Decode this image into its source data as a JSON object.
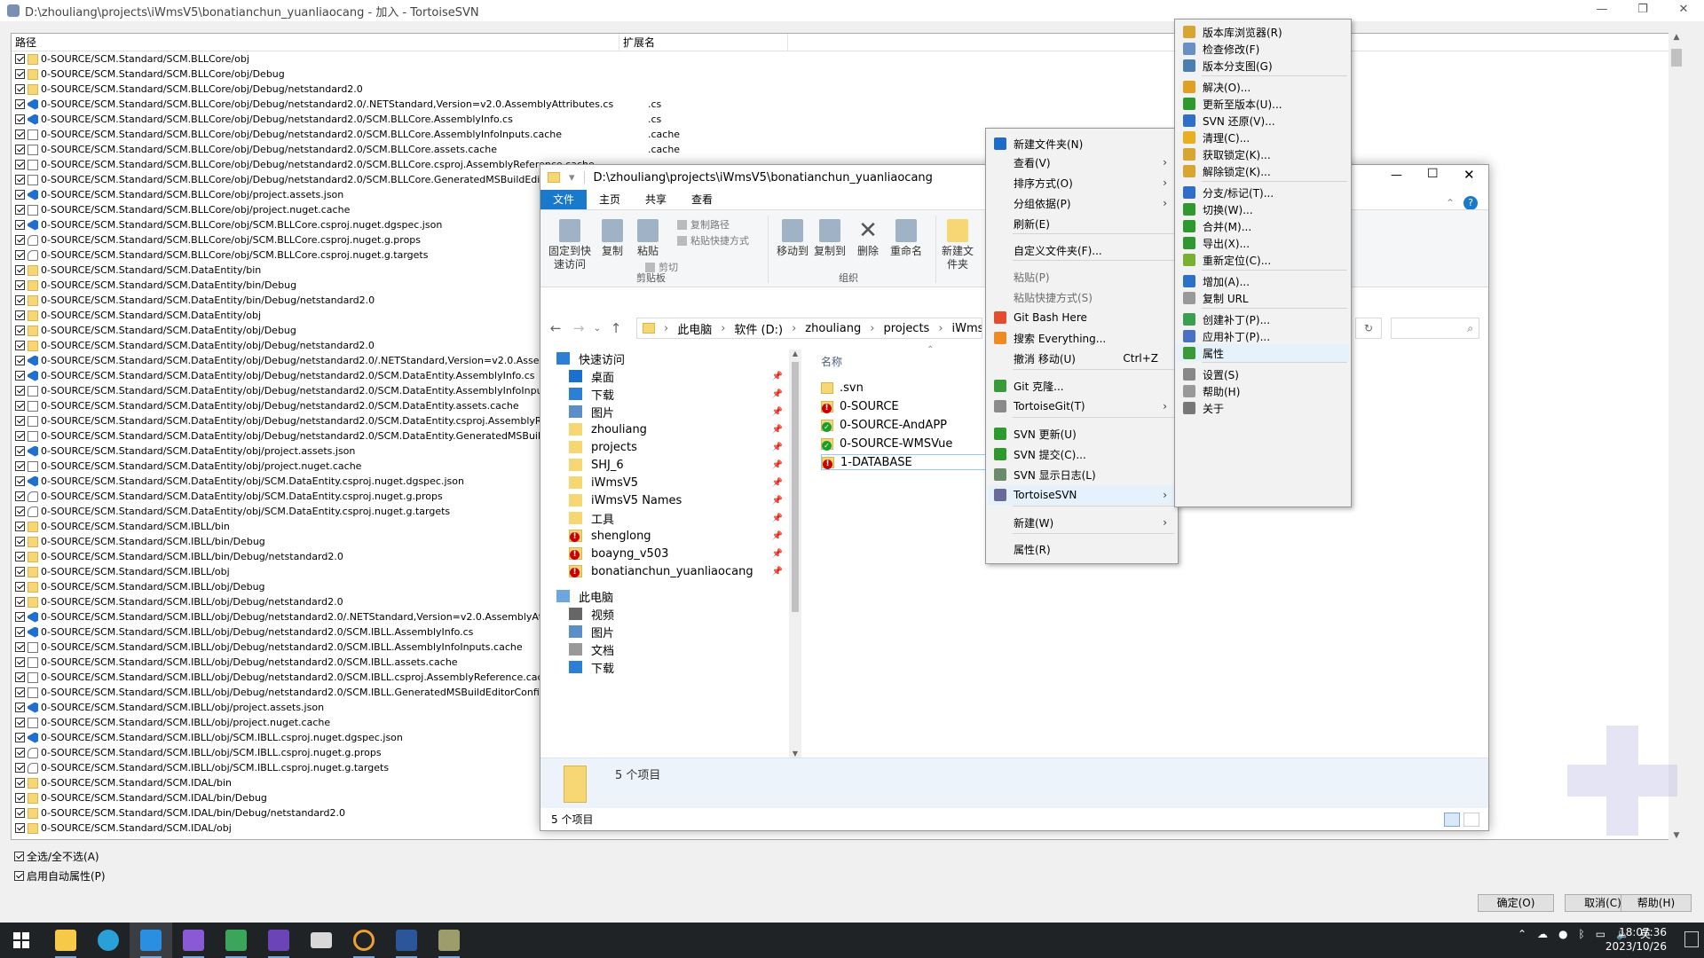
{
  "svn": {
    "title": "D:\\zhouliang\\projects\\iWmsV5\\bonatianchun_yuanliaocang - 加入 - TortoiseSVN",
    "col_path": "路径",
    "col_ext": "扩展名",
    "files": [
      {
        "path": "0-SOURCE/SCM.Standard/SCM.BLLCore/obj",
        "ext": "",
        "icon": "folder"
      },
      {
        "path": "0-SOURCE/SCM.Standard/SCM.BLLCore/obj/Debug",
        "ext": "",
        "icon": "folder"
      },
      {
        "path": "0-SOURCE/SCM.Standard/SCM.BLLCore/obj/Debug/netstandard2.0",
        "ext": "",
        "icon": "folder"
      },
      {
        "path": "0-SOURCE/SCM.Standard/SCM.BLLCore/obj/Debug/netstandard2.0/.NETStandard,Version=v2.0.AssemblyAttributes.cs",
        "ext": ".cs",
        "icon": "vs"
      },
      {
        "path": "0-SOURCE/SCM.Standard/SCM.BLLCore/obj/Debug/netstandard2.0/SCM.BLLCore.AssemblyInfo.cs",
        "ext": ".cs",
        "icon": "vs"
      },
      {
        "path": "0-SOURCE/SCM.Standard/SCM.BLLCore/obj/Debug/netstandard2.0/SCM.BLLCore.AssemblyInfoInputs.cache",
        "ext": ".cache",
        "icon": "file"
      },
      {
        "path": "0-SOURCE/SCM.Standard/SCM.BLLCore/obj/Debug/netstandard2.0/SCM.BLLCore.assets.cache",
        "ext": ".cache",
        "icon": "file"
      },
      {
        "path": "0-SOURCE/SCM.Standard/SCM.BLLCore/obj/Debug/netstandard2.0/SCM.BLLCore.csproj.AssemblyReference.cache",
        "ext": "",
        "icon": "file"
      },
      {
        "path": "0-SOURCE/SCM.Standard/SCM.BLLCore/obj/Debug/netstandard2.0/SCM.BLLCore.GeneratedMSBuildEditorConfig.ed",
        "ext": "",
        "icon": "file"
      },
      {
        "path": "0-SOURCE/SCM.Standard/SCM.BLLCore/obj/project.assets.json",
        "ext": "",
        "icon": "vs"
      },
      {
        "path": "0-SOURCE/SCM.Standard/SCM.BLLCore/obj/project.nuget.cache",
        "ext": "",
        "icon": "file"
      },
      {
        "path": "0-SOURCE/SCM.Standard/SCM.BLLCore/obj/SCM.BLLCore.csproj.nuget.dgspec.json",
        "ext": "",
        "icon": "vs"
      },
      {
        "path": "0-SOURCE/SCM.Standard/SCM.BLLCore/obj/SCM.BLLCore.csproj.nuget.g.props",
        "ext": "",
        "icon": "cfg"
      },
      {
        "path": "0-SOURCE/SCM.Standard/SCM.BLLCore/obj/SCM.BLLCore.csproj.nuget.g.targets",
        "ext": "",
        "icon": "cfg"
      },
      {
        "path": "0-SOURCE/SCM.Standard/SCM.DataEntity/bin",
        "ext": "",
        "icon": "folder"
      },
      {
        "path": "0-SOURCE/SCM.Standard/SCM.DataEntity/bin/Debug",
        "ext": "",
        "icon": "folder"
      },
      {
        "path": "0-SOURCE/SCM.Standard/SCM.DataEntity/bin/Debug/netstandard2.0",
        "ext": "",
        "icon": "folder"
      },
      {
        "path": "0-SOURCE/SCM.Standard/SCM.DataEntity/obj",
        "ext": "",
        "icon": "folder"
      },
      {
        "path": "0-SOURCE/SCM.Standard/SCM.DataEntity/obj/Debug",
        "ext": "",
        "icon": "folder"
      },
      {
        "path": "0-SOURCE/SCM.Standard/SCM.DataEntity/obj/Debug/netstandard2.0",
        "ext": "",
        "icon": "folder"
      },
      {
        "path": "0-SOURCE/SCM.Standard/SCM.DataEntity/obj/Debug/netstandard2.0/.NETStandard,Version=v2.0.AssemblyAttribu",
        "ext": "",
        "icon": "vs"
      },
      {
        "path": "0-SOURCE/SCM.Standard/SCM.DataEntity/obj/Debug/netstandard2.0/SCM.DataEntity.AssemblyInfo.cs",
        "ext": "",
        "icon": "vs"
      },
      {
        "path": "0-SOURCE/SCM.Standard/SCM.DataEntity/obj/Debug/netstandard2.0/SCM.DataEntity.AssemblyInfoInputs.cache",
        "ext": "",
        "icon": "file"
      },
      {
        "path": "0-SOURCE/SCM.Standard/SCM.DataEntity/obj/Debug/netstandard2.0/SCM.DataEntity.assets.cache",
        "ext": "",
        "icon": "file"
      },
      {
        "path": "0-SOURCE/SCM.Standard/SCM.DataEntity/obj/Debug/netstandard2.0/SCM.DataEntity.csproj.AssemblyReference.c",
        "ext": "",
        "icon": "file"
      },
      {
        "path": "0-SOURCE/SCM.Standard/SCM.DataEntity/obj/Debug/netstandard2.0/SCM.DataEntity.GeneratedMSBuildEditorConf",
        "ext": "",
        "icon": "file"
      },
      {
        "path": "0-SOURCE/SCM.Standard/SCM.DataEntity/obj/project.assets.json",
        "ext": "",
        "icon": "vs"
      },
      {
        "path": "0-SOURCE/SCM.Standard/SCM.DataEntity/obj/project.nuget.cache",
        "ext": "",
        "icon": "file"
      },
      {
        "path": "0-SOURCE/SCM.Standard/SCM.DataEntity/obj/SCM.DataEntity.csproj.nuget.dgspec.json",
        "ext": "",
        "icon": "vs"
      },
      {
        "path": "0-SOURCE/SCM.Standard/SCM.DataEntity/obj/SCM.DataEntity.csproj.nuget.g.props",
        "ext": "",
        "icon": "cfg"
      },
      {
        "path": "0-SOURCE/SCM.Standard/SCM.DataEntity/obj/SCM.DataEntity.csproj.nuget.g.targets",
        "ext": "",
        "icon": "cfg"
      },
      {
        "path": "0-SOURCE/SCM.Standard/SCM.IBLL/bin",
        "ext": "",
        "icon": "folder"
      },
      {
        "path": "0-SOURCE/SCM.Standard/SCM.IBLL/bin/Debug",
        "ext": "",
        "icon": "folder"
      },
      {
        "path": "0-SOURCE/SCM.Standard/SCM.IBLL/bin/Debug/netstandard2.0",
        "ext": "",
        "icon": "folder"
      },
      {
        "path": "0-SOURCE/SCM.Standard/SCM.IBLL/obj",
        "ext": "",
        "icon": "folder"
      },
      {
        "path": "0-SOURCE/SCM.Standard/SCM.IBLL/obj/Debug",
        "ext": "",
        "icon": "folder"
      },
      {
        "path": "0-SOURCE/SCM.Standard/SCM.IBLL/obj/Debug/netstandard2.0",
        "ext": "",
        "icon": "folder"
      },
      {
        "path": "0-SOURCE/SCM.Standard/SCM.IBLL/obj/Debug/netstandard2.0/.NETStandard,Version=v2.0.AssemblyAttributes.cs",
        "ext": "",
        "icon": "vs"
      },
      {
        "path": "0-SOURCE/SCM.Standard/SCM.IBLL/obj/Debug/netstandard2.0/SCM.IBLL.AssemblyInfo.cs",
        "ext": "",
        "icon": "vs"
      },
      {
        "path": "0-SOURCE/SCM.Standard/SCM.IBLL/obj/Debug/netstandard2.0/SCM.IBLL.AssemblyInfoInputs.cache",
        "ext": "",
        "icon": "file"
      },
      {
        "path": "0-SOURCE/SCM.Standard/SCM.IBLL/obj/Debug/netstandard2.0/SCM.IBLL.assets.cache",
        "ext": "",
        "icon": "file"
      },
      {
        "path": "0-SOURCE/SCM.Standard/SCM.IBLL/obj/Debug/netstandard2.0/SCM.IBLL.csproj.AssemblyReference.cache",
        "ext": "",
        "icon": "file"
      },
      {
        "path": "0-SOURCE/SCM.Standard/SCM.IBLL/obj/Debug/netstandard2.0/SCM.IBLL.GeneratedMSBuildEditorConfig.editorconf",
        "ext": "",
        "icon": "file"
      },
      {
        "path": "0-SOURCE/SCM.Standard/SCM.IBLL/obj/project.assets.json",
        "ext": "",
        "icon": "vs"
      },
      {
        "path": "0-SOURCE/SCM.Standard/SCM.IBLL/obj/project.nuget.cache",
        "ext": "",
        "icon": "file"
      },
      {
        "path": "0-SOURCE/SCM.Standard/SCM.IBLL/obj/SCM.IBLL.csproj.nuget.dgspec.json",
        "ext": "",
        "icon": "vs"
      },
      {
        "path": "0-SOURCE/SCM.Standard/SCM.IBLL/obj/SCM.IBLL.csproj.nuget.g.props",
        "ext": "",
        "icon": "cfg"
      },
      {
        "path": "0-SOURCE/SCM.Standard/SCM.IBLL/obj/SCM.IBLL.csproj.nuget.g.targets",
        "ext": "",
        "icon": "cfg"
      },
      {
        "path": "0-SOURCE/SCM.Standard/SCM.IDAL/bin",
        "ext": "",
        "icon": "folder"
      },
      {
        "path": "0-SOURCE/SCM.Standard/SCM.IDAL/bin/Debug",
        "ext": "",
        "icon": "folder"
      },
      {
        "path": "0-SOURCE/SCM.Standard/SCM.IDAL/bin/Debug/netstandard2.0",
        "ext": "",
        "icon": "folder"
      },
      {
        "path": "0-SOURCE/SCM.Standard/SCM.IDAL/obj",
        "ext": "",
        "icon": "folder"
      }
    ],
    "select_all": "全选/全不选(A)",
    "auto_props": "启用自动属性(P)",
    "ok": "确定(O)",
    "cancel": "取消(C)",
    "help": "帮助(H)"
  },
  "explorer": {
    "title": "D:\\zhouliang\\projects\\iWmsV5\\bonatianchun_yuanliaocang",
    "tabs": [
      "文件",
      "主页",
      "共享",
      "查看"
    ],
    "ribbon": {
      "pin": "固定到快速访问",
      "copy": "复制",
      "paste": "粘贴",
      "copy_path": "复制路径",
      "paste_shortcut": "粘贴快捷方式",
      "cut": "剪切",
      "move_to": "移动到",
      "copy_to": "复制到",
      "delete": "删除",
      "rename": "重命名",
      "new_folder": "新建文件夹",
      "group_clipboard": "剪贴板",
      "group_organize": "组织"
    },
    "breadcrumb": [
      "此电脑",
      "软件 (D:)",
      "zhouliang",
      "projects",
      "iWmsV5"
    ],
    "nav": [
      {
        "label": "快速访问",
        "icon": "star",
        "pin": false,
        "indent": 0
      },
      {
        "label": "桌面",
        "icon": "desktop",
        "pin": true,
        "indent": 1
      },
      {
        "label": "下载",
        "icon": "download",
        "pin": true,
        "indent": 1
      },
      {
        "label": "图片",
        "icon": "pictures",
        "pin": true,
        "indent": 1
      },
      {
        "label": "zhouliang",
        "icon": "folder",
        "pin": true,
        "indent": 1
      },
      {
        "label": "projects",
        "icon": "folder",
        "pin": true,
        "indent": 1
      },
      {
        "label": "SHJ_6",
        "icon": "folder",
        "pin": true,
        "indent": 1
      },
      {
        "label": "iWmsV5",
        "icon": "folder",
        "pin": true,
        "indent": 1
      },
      {
        "label": "iWmsV5 Names",
        "icon": "folder",
        "pin": true,
        "indent": 1
      },
      {
        "label": "工具",
        "icon": "folder",
        "pin": true,
        "indent": 1
      },
      {
        "label": "shenglong",
        "icon": "svn-folder",
        "pin": true,
        "indent": 1
      },
      {
        "label": "boayng_v503",
        "icon": "svn-folder",
        "pin": true,
        "indent": 1
      },
      {
        "label": "bonatianchun_yuanliaocang",
        "icon": "svn-folder",
        "pin": true,
        "indent": 1
      },
      {
        "label": "此电脑",
        "icon": "computer",
        "pin": false,
        "indent": 0
      },
      {
        "label": "视频",
        "icon": "video",
        "pin": false,
        "indent": 1
      },
      {
        "label": "图片",
        "icon": "pictures",
        "pin": false,
        "indent": 1
      },
      {
        "label": "文档",
        "icon": "documents",
        "pin": false,
        "indent": 1
      },
      {
        "label": "下载",
        "icon": "download",
        "pin": false,
        "indent": 1
      }
    ],
    "col_name": "名称",
    "items": [
      {
        "name": ".svn",
        "status": "plain"
      },
      {
        "name": "0-SOURCE",
        "status": "modified"
      },
      {
        "name": "0-SOURCE-AndAPP",
        "status": "normal"
      },
      {
        "name": "0-SOURCE-WMSVue",
        "status": "normal"
      },
      {
        "name": "1-DATABASE",
        "status": "modified"
      }
    ],
    "details_count": "5 个项目",
    "status_count": "5 个项目"
  },
  "context_menu": {
    "items": [
      {
        "label": "新建文件夹(N)",
        "icon": "new-folder",
        "arrow": false
      },
      {
        "label": "查看(V)",
        "arrow": true
      },
      {
        "label": "排序方式(O)",
        "arrow": true
      },
      {
        "label": "分组依据(P)",
        "arrow": true
      },
      {
        "label": "刷新(E)",
        "arrow": false
      },
      {
        "label": "自定义文件夹(F)...",
        "arrow": false
      },
      {
        "label": "粘贴(P)",
        "disabled": true
      },
      {
        "label": "粘贴快捷方式(S)",
        "disabled": true
      },
      {
        "label": "Git Bash Here",
        "icon": "git-bash"
      },
      {
        "label": "搜索 Everything...",
        "icon": "everything"
      },
      {
        "label": "撤消 移动(U)",
        "shortcut": "Ctrl+Z"
      },
      {
        "label": "Git 克隆...",
        "icon": "git"
      },
      {
        "label": "TortoiseGit(T)",
        "icon": "tortoisegit",
        "arrow": true
      },
      {
        "label": "SVN 更新(U)",
        "icon": "svn-update"
      },
      {
        "label": "SVN 提交(C)...",
        "icon": "svn-commit"
      },
      {
        "label": "SVN 显示日志(L)",
        "icon": "svn-log"
      },
      {
        "label": "TortoiseSVN",
        "icon": "tortoisesvn",
        "arrow": true,
        "highlight": true
      },
      {
        "label": "新建(W)",
        "arrow": true
      },
      {
        "label": "属性(R)"
      }
    ]
  },
  "svn_submenu": {
    "items": [
      {
        "label": "版本库浏览器(R)",
        "icon": "repo-browser"
      },
      {
        "label": "检查修改(F)",
        "icon": "check-mods"
      },
      {
        "label": "版本分支图(G)",
        "icon": "revision-graph"
      },
      {
        "label": "解决(O)...",
        "icon": "resolve"
      },
      {
        "label": "更新至版本(U)...",
        "icon": "update-rev"
      },
      {
        "label": "SVN 还原(V)...",
        "icon": "revert"
      },
      {
        "label": "清理(C)...",
        "icon": "cleanup"
      },
      {
        "label": "获取锁定(K)...",
        "icon": "lock"
      },
      {
        "label": "解除锁定(K)...",
        "icon": "unlock"
      },
      {
        "label": "分支/标记(T)...",
        "icon": "branch"
      },
      {
        "label": "切换(W)...",
        "icon": "switch"
      },
      {
        "label": "合并(M)...",
        "icon": "merge"
      },
      {
        "label": "导出(X)...",
        "icon": "export"
      },
      {
        "label": "重新定位(C)...",
        "icon": "relocate"
      },
      {
        "label": "增加(A)...",
        "icon": "add"
      },
      {
        "label": "复制 URL",
        "icon": "copy-url"
      },
      {
        "label": "创建补丁(P)...",
        "icon": "create-patch"
      },
      {
        "label": "应用补丁(P)...",
        "icon": "apply-patch"
      },
      {
        "label": "属性",
        "icon": "properties",
        "highlight": true
      },
      {
        "label": "设置(S)",
        "icon": "settings"
      },
      {
        "label": "帮助(H)",
        "icon": "help"
      },
      {
        "label": "关于",
        "icon": "about"
      }
    ]
  },
  "taskbar": {
    "time": "18:07:36",
    "date": "2023/10/26"
  },
  "colors": {
    "accent": "#1979ca",
    "svn_ok": "#1a9e2a",
    "svn_err": "#c00000",
    "taskbar": "#202326"
  }
}
